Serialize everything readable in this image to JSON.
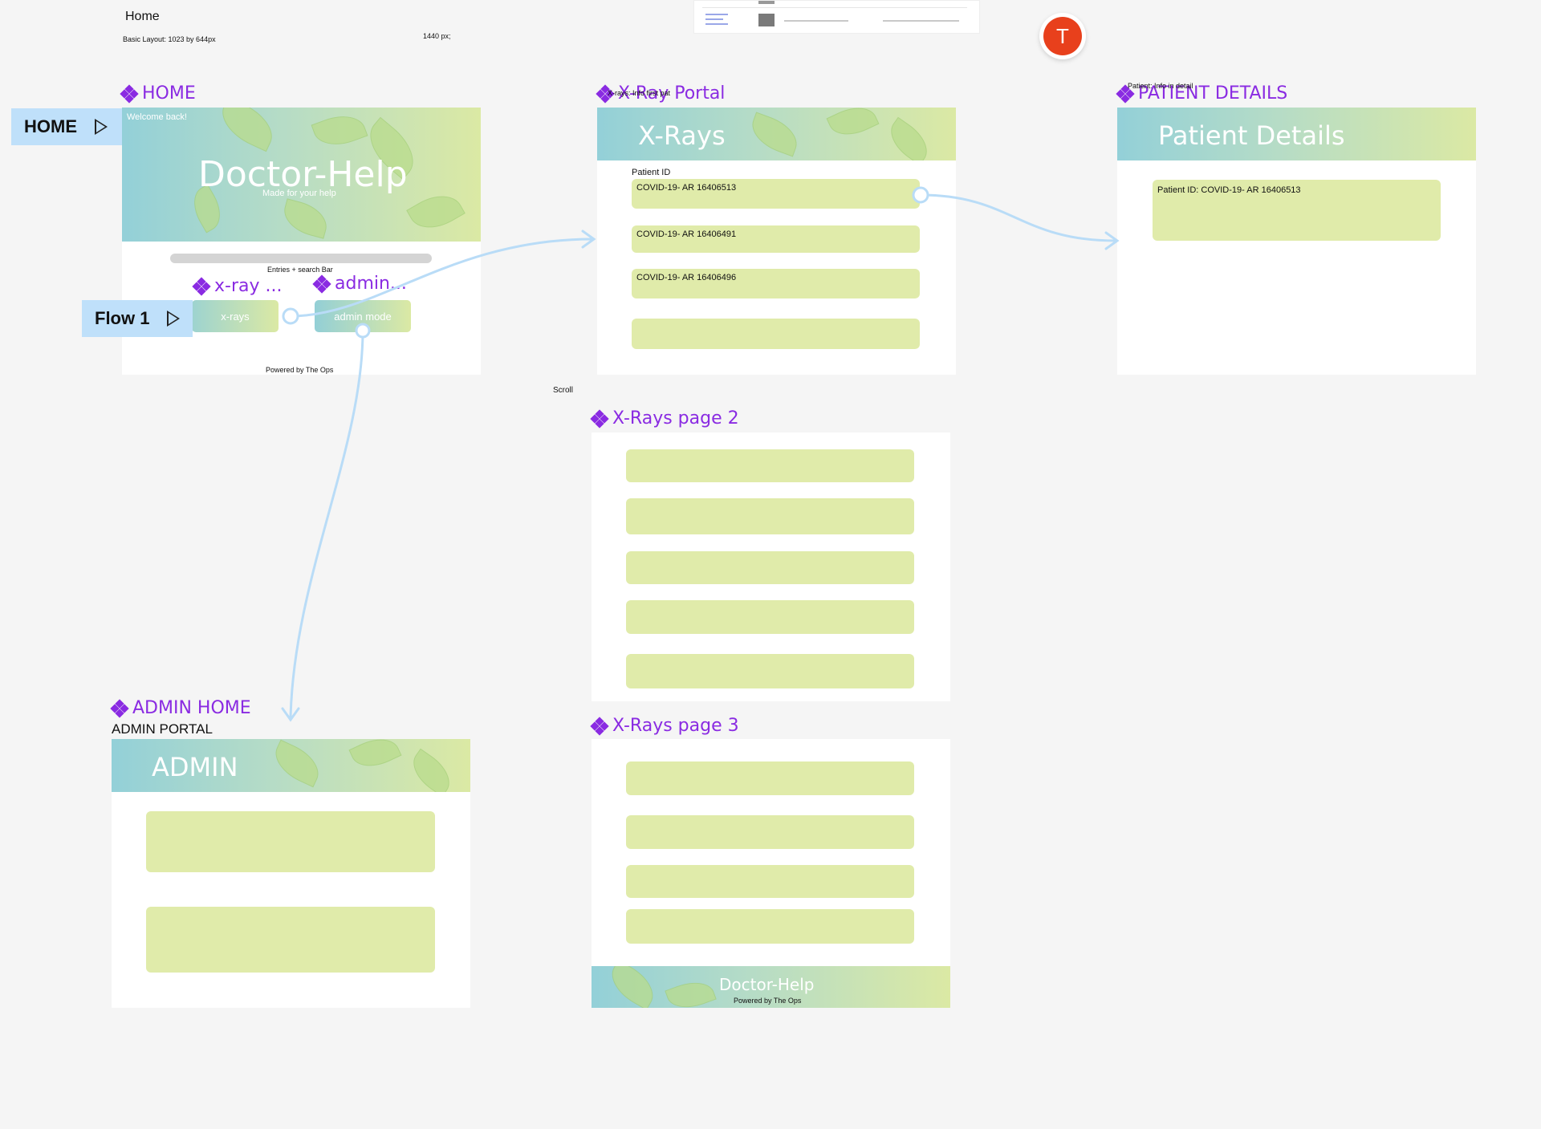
{
  "canvas": {
    "page_name": "Home",
    "note_layout": "Basic Layout: 1023 by 644px",
    "note_width": "1440 px;",
    "note_scroll": "Scroll",
    "avatar_initial": "T",
    "avatar_color": "#e8401c",
    "accent_color": "#8a2be2",
    "connector_color": "#b9dcf7"
  },
  "flows": {
    "home_flow": "HOME",
    "flow1": "Flow 1"
  },
  "home": {
    "frame_label": "HOME",
    "welcome": "Welcome back!",
    "title": "Doctor-Help",
    "subtitle": "Made for your help",
    "search_label": "Entries + search Bar",
    "xray_component_label": "x-ray ...",
    "admin_component_label": "admin...",
    "xray_button": "x-rays",
    "admin_button": "admin mode",
    "footer": "Powered by The Ops"
  },
  "xray_portal": {
    "frame_label": "X-Ray Portal",
    "overlay_note": "X-rays: Info first pat",
    "title": "X-Rays",
    "column_label": "Patient ID",
    "rows": [
      "COVID-19- AR 16406513",
      "COVID-19- AR 16406491",
      "COVID-19- AR 16406496",
      ""
    ]
  },
  "patient_details": {
    "frame_label": "PATIENT DETAILS",
    "overlay_note": "Patient: Info in detail",
    "title": "Patient Details",
    "card_text": "Patient ID: COVID-19- AR 16406513"
  },
  "xray_page2": {
    "frame_label": "X-Rays page 2"
  },
  "xray_page3": {
    "frame_label": "X-Rays page 3",
    "footer_title": "Doctor-Help",
    "footer_sub": "Powered by The Ops"
  },
  "admin_home": {
    "frame_label": "ADMIN HOME",
    "subtitle_label": "ADMIN PORTAL",
    "title": "ADMIN"
  }
}
